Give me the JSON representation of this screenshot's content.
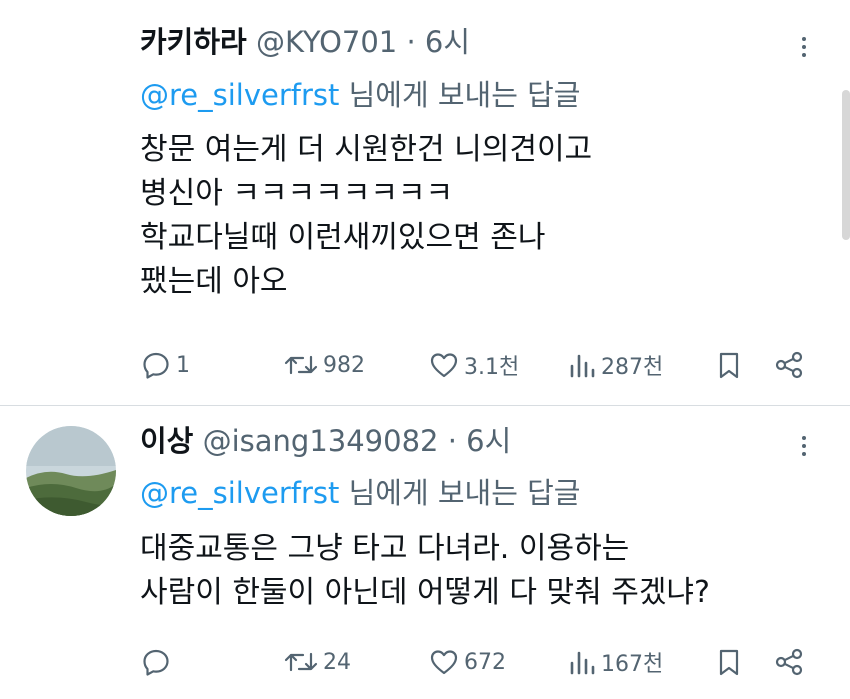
{
  "tweets": [
    {
      "name": "카키하라",
      "handle": "@KYO701",
      "time": "· 6시",
      "reply_mention": "@re_silverfrst",
      "reply_suffix": " 님에게 보내는 답글",
      "lines": [
        "창문 여는게 더 시원한건 니의견이고",
        "병신아 ㅋㅋㅋㅋㅋㅋㅋㅋ",
        "학교다닐때 이런새끼있으면 존나",
        "팼는데 아오"
      ],
      "replies": "1",
      "retweets": "982",
      "likes": "3.1천",
      "views": "287천"
    },
    {
      "name": "이상",
      "handle": "@isang1349082",
      "time": "· 6시",
      "reply_mention": "@re_silverfrst",
      "reply_suffix": " 님에게 보내는 답글",
      "lines": [
        "대중교통은 그냥 타고 다녀라. 이용하는",
        "사람이 한둘이 아닌데 어떻게 다 맞춰 주겠냐?"
      ],
      "replies": "",
      "retweets": "24",
      "likes": "672",
      "views": "167천"
    }
  ],
  "icons": {
    "reply": "reply-icon",
    "retweet": "retweet-icon",
    "like": "heart-icon",
    "views": "views-icon",
    "bookmark": "bookmark-icon",
    "share": "share-icon",
    "more": "more-icon"
  },
  "colors": {
    "text": "#0f1419",
    "secondary": "#536471",
    "link": "#1d9bf0",
    "divider": "#d8dde1"
  }
}
